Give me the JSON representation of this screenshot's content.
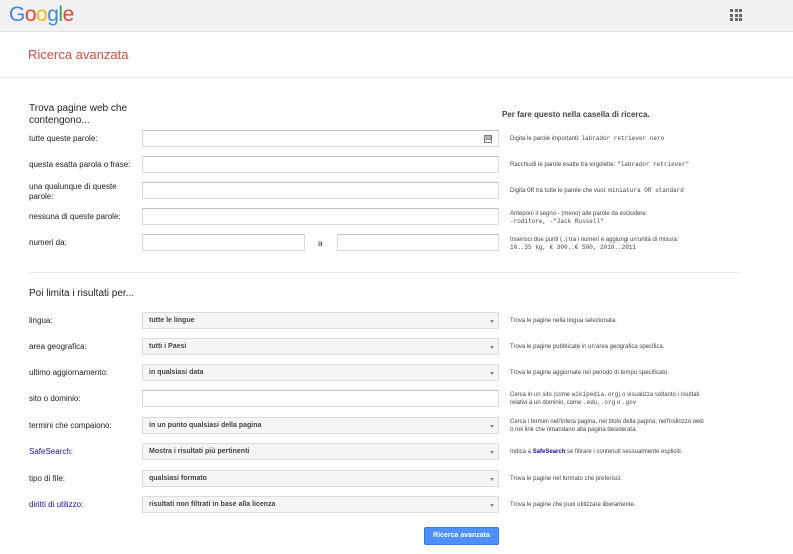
{
  "header": {
    "logo": [
      "G",
      "o",
      "o",
      "g",
      "l",
      "e"
    ],
    "logo_colors": [
      "#4285f4",
      "#ea4335",
      "#fbbc05",
      "#4285f4",
      "#34a853",
      "#ea4335"
    ],
    "apps_icon": "apps-grid-icon"
  },
  "page_title": "Ricerca avanzata",
  "section1": {
    "title_line1": "Trova pagine web che",
    "title_line2": "contengono...",
    "hint_heading": "Per fare questo nella casella di ricerca.",
    "rows": [
      {
        "label": "tutte queste parole:",
        "hint_text": "Digita le parole importanti: ",
        "hint_code": "labrador retriever nero"
      },
      {
        "label": "questa esatta parola o frase:",
        "hint_text": "Racchiudi le parole esatte tra virgolette: ",
        "hint_code": "\"labrador retriever\""
      },
      {
        "label_line1": "una qualunque di queste",
        "label_line2": "parole:",
        "hint_pre": "Digita ",
        "hint_code1": "OR",
        "hint_mid": " tra tutte le parole che vuoi: ",
        "hint_code2": "miniatura OR standard"
      },
      {
        "label": "nessuna di queste parole:",
        "hint_line1": "Anteponi il segno - (meno) alle parole da escludere:",
        "hint_code": "-roditore, -\"Jack Russell\""
      },
      {
        "label": "numeri da:",
        "to_label": "a",
        "hint_line1": "Inserisci due punti (..) tra i numeri e aggiungi un'unità di misura:",
        "hint_code": "10..35 kg, € 300..€ 500, 2010..2011"
      }
    ]
  },
  "section2": {
    "title": "Poi limita i risultati per...",
    "rows": [
      {
        "label": "lingua:",
        "value": "tutte le lingue",
        "hint": "Trova le pagine nella lingua selezionata."
      },
      {
        "label": "area geografica:",
        "value": "tutti i Paesi",
        "hint": "Trova le pagine pubblicate in un'area geografica specifica."
      },
      {
        "label": "ultimo aggiornamento:",
        "value": "in qualsiasi data",
        "hint": "Trova le pagine aggiornate nel periodo di tempo specificato."
      },
      {
        "label": "sito o dominio:",
        "hint_pre": "Cerca in un sito (come ",
        "hint_code1": "wikipedia.org",
        "hint_mid": ") o visualizza soltanto i risultati",
        "hint_line2_pre": "relativi a un dominio, come ",
        "hint_code2": ".edu",
        "hint_sep1": ", ",
        "hint_code3": ".org",
        "hint_sep2": " o ",
        "hint_code4": ".gov"
      },
      {
        "label": "termini che compaiono:",
        "value": "in un punto qualsiasi della pagina",
        "hint_line1": "Cerca i termini nell'intera pagina, nel titolo della pagina, nell'indirizzo web",
        "hint_line2": "o nei link che rimandano alla pagina desiderata."
      },
      {
        "label": "SafeSearch:",
        "value": "Mostra i risultati più pertinenti",
        "hint_pre": "Indica a ",
        "hint_link": "SafeSearch",
        "hint_post": " se filtrare i contenuti sessualmente espliciti."
      },
      {
        "label": "tipo di file:",
        "value": "qualsiasi formato",
        "hint": "Trova le pagine nel formato che preferisci."
      },
      {
        "label": "diritti di utilizzo:",
        "value": "risultati non filtrati in base alla licenza",
        "hint": "Trova le pagine che puoi utilizzare liberamente."
      }
    ]
  },
  "submit_label": "Ricerca avanzata"
}
